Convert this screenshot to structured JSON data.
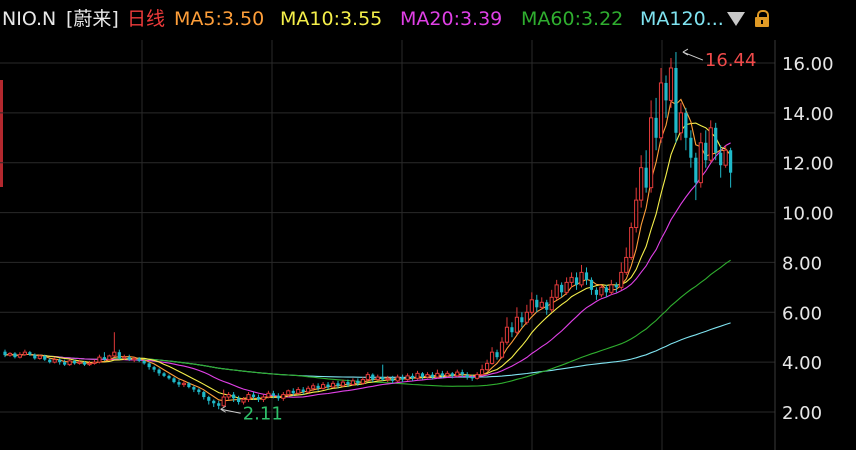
{
  "header": {
    "symbol": "NIO.N",
    "name": "[蔚来]",
    "period": "日线",
    "ma5": "MA5:3.50",
    "ma10": "MA10:3.55",
    "ma20": "MA20:3.39",
    "ma60": "MA60:3.22",
    "ma120": "MA120..."
  },
  "colors": {
    "background": "#000000",
    "up": "#e03a3a",
    "down": "#1fb9c9",
    "ma5": "#ff9f3a",
    "ma10": "#f5ef4a",
    "ma20": "#e040e6",
    "ma60": "#2fae2f",
    "ma120": "#7fe3f0",
    "grid": "#2a2a2a",
    "max_label": "#f04a4a",
    "min_label": "#2fc06a"
  },
  "icons": [
    "dropdown-triangle-icon",
    "lock-icon"
  ],
  "chart_data": {
    "type": "candlestick",
    "grid": true,
    "y_axis_position": "right",
    "ylim": [
      1.25,
      17.3
    ],
    "y_ticks": [
      2,
      4,
      6,
      8,
      10,
      12,
      14,
      16
    ],
    "y_tick_labels": [
      "2.00",
      "4.00",
      "6.00",
      "8.00",
      "10.00",
      "12.00",
      "14.00",
      "16.00"
    ],
    "annotations": [
      {
        "label": "16.44",
        "kind": "max",
        "value": 16.44,
        "candle_index": 136
      },
      {
        "label": "2.11",
        "kind": "min",
        "value": 2.11,
        "candle_index": 43
      }
    ],
    "candles": [
      [
        4.42,
        4.28,
        4.5,
        4.2
      ],
      [
        4.28,
        4.35,
        4.4,
        4.22
      ],
      [
        4.35,
        4.2,
        4.4,
        4.15
      ],
      [
        4.2,
        4.3,
        4.4,
        4.15
      ],
      [
        4.3,
        4.4,
        4.5,
        4.25
      ],
      [
        4.4,
        4.3,
        4.45,
        4.25
      ],
      [
        4.3,
        4.15,
        4.35,
        4.1
      ],
      [
        4.15,
        4.25,
        4.3,
        4.1
      ],
      [
        4.25,
        4.1,
        4.3,
        4.05
      ],
      [
        4.1,
        4.0,
        4.15,
        3.95
      ],
      [
        4.0,
        4.1,
        4.2,
        3.95
      ],
      [
        4.1,
        4.0,
        4.15,
        3.9
      ],
      [
        4.0,
        3.9,
        4.1,
        3.85
      ],
      [
        3.9,
        4.05,
        4.1,
        3.85
      ],
      [
        4.05,
        3.95,
        4.1,
        3.9
      ],
      [
        3.95,
        4.0,
        4.1,
        3.9
      ],
      [
        4.0,
        3.9,
        4.05,
        3.85
      ],
      [
        3.9,
        3.95,
        4.05,
        3.85
      ],
      [
        3.95,
        4.0,
        4.1,
        3.9
      ],
      [
        4.0,
        4.2,
        4.3,
        3.95
      ],
      [
        4.2,
        4.1,
        4.4,
        4.05
      ],
      [
        4.1,
        4.25,
        4.3,
        4.05
      ],
      [
        4.25,
        4.4,
        5.2,
        4.2
      ],
      [
        4.4,
        4.15,
        4.5,
        4.1
      ],
      [
        4.15,
        4.2,
        4.3,
        4.1
      ],
      [
        4.2,
        4.1,
        4.3,
        4.05
      ],
      [
        4.1,
        4.15,
        4.2,
        4.0
      ],
      [
        4.15,
        4.05,
        4.2,
        4.0
      ],
      [
        4.05,
        3.95,
        4.1,
        3.9
      ],
      [
        3.95,
        3.8,
        4.0,
        3.7
      ],
      [
        3.8,
        3.7,
        3.85,
        3.6
      ],
      [
        3.7,
        3.55,
        3.75,
        3.45
      ],
      [
        3.55,
        3.45,
        3.6,
        3.4
      ],
      [
        3.45,
        3.35,
        3.5,
        3.3
      ],
      [
        3.35,
        3.2,
        3.4,
        3.15
      ],
      [
        3.2,
        3.1,
        3.3,
        3.0
      ],
      [
        3.1,
        3.15,
        3.25,
        3.0
      ],
      [
        3.15,
        3.0,
        3.2,
        2.95
      ],
      [
        3.0,
        2.9,
        3.05,
        2.8
      ],
      [
        2.9,
        2.8,
        2.95,
        2.7
      ],
      [
        2.8,
        2.6,
        2.85,
        2.5
      ],
      [
        2.6,
        2.45,
        2.65,
        2.3
      ],
      [
        2.45,
        2.35,
        2.5,
        2.2
      ],
      [
        2.35,
        2.25,
        2.45,
        2.11
      ],
      [
        2.25,
        2.6,
        2.9,
        2.2
      ],
      [
        2.6,
        2.7,
        2.8,
        2.5
      ],
      [
        2.7,
        2.55,
        2.8,
        2.4
      ],
      [
        2.55,
        2.4,
        2.65,
        2.3
      ],
      [
        2.4,
        2.5,
        2.6,
        2.3
      ],
      [
        2.5,
        2.7,
        2.8,
        2.4
      ],
      [
        2.7,
        2.6,
        2.8,
        2.5
      ],
      [
        2.6,
        2.5,
        2.7,
        2.4
      ],
      [
        2.5,
        2.6,
        2.7,
        2.4
      ],
      [
        2.6,
        2.75,
        2.85,
        2.55
      ],
      [
        2.75,
        2.65,
        2.85,
        2.55
      ],
      [
        2.65,
        2.55,
        2.75,
        2.45
      ],
      [
        2.55,
        2.7,
        2.8,
        2.45
      ],
      [
        2.7,
        2.85,
        2.9,
        2.6
      ],
      [
        2.85,
        2.75,
        2.95,
        2.65
      ],
      [
        2.75,
        2.9,
        3.0,
        2.7
      ],
      [
        2.9,
        2.8,
        3.0,
        2.7
      ],
      [
        2.8,
        2.95,
        3.05,
        2.75
      ],
      [
        2.95,
        3.05,
        3.15,
        2.85
      ],
      [
        3.05,
        2.95,
        3.15,
        2.85
      ],
      [
        2.95,
        3.1,
        3.2,
        2.9
      ],
      [
        3.1,
        3.0,
        3.2,
        2.9
      ],
      [
        3.0,
        3.15,
        3.25,
        2.95
      ],
      [
        3.15,
        3.05,
        3.25,
        2.95
      ],
      [
        3.05,
        3.2,
        3.3,
        3.0
      ],
      [
        3.2,
        3.1,
        3.3,
        3.0
      ],
      [
        3.1,
        3.25,
        3.35,
        3.05
      ],
      [
        3.25,
        3.15,
        3.35,
        3.05
      ],
      [
        3.15,
        3.3,
        3.4,
        3.1
      ],
      [
        3.3,
        3.5,
        3.6,
        3.2
      ],
      [
        3.5,
        3.3,
        3.55,
        3.2
      ],
      [
        3.3,
        3.4,
        3.5,
        3.25
      ],
      [
        3.4,
        3.3,
        3.9,
        3.25
      ],
      [
        3.3,
        3.35,
        3.45,
        3.2
      ],
      [
        3.35,
        3.25,
        3.45,
        3.15
      ],
      [
        3.25,
        3.4,
        3.5,
        3.2
      ],
      [
        3.4,
        3.3,
        3.5,
        3.2
      ],
      [
        3.3,
        3.45,
        3.55,
        3.25
      ],
      [
        3.45,
        3.35,
        3.55,
        3.25
      ],
      [
        3.35,
        3.55,
        3.65,
        3.3
      ],
      [
        3.55,
        3.4,
        3.6,
        3.3
      ],
      [
        3.4,
        3.5,
        3.6,
        3.35
      ],
      [
        3.5,
        3.4,
        3.6,
        3.3
      ],
      [
        3.4,
        3.55,
        3.7,
        3.35
      ],
      [
        3.55,
        3.45,
        3.65,
        3.35
      ],
      [
        3.45,
        3.55,
        3.65,
        3.4
      ],
      [
        3.55,
        3.45,
        3.6,
        3.35
      ],
      [
        3.45,
        3.6,
        3.7,
        3.4
      ],
      [
        3.6,
        3.5,
        3.7,
        3.4
      ],
      [
        3.5,
        3.4,
        3.6,
        3.3
      ],
      [
        3.4,
        3.35,
        3.5,
        3.25
      ],
      [
        3.35,
        3.5,
        3.6,
        3.3
      ],
      [
        3.5,
        3.7,
        3.9,
        3.45
      ],
      [
        3.7,
        3.95,
        4.1,
        3.65
      ],
      [
        3.95,
        4.4,
        4.6,
        3.9
      ],
      [
        4.4,
        4.2,
        4.5,
        4.1
      ],
      [
        4.2,
        4.8,
        5.0,
        4.15
      ],
      [
        4.8,
        5.4,
        5.8,
        4.7
      ],
      [
        5.4,
        5.2,
        5.6,
        5.0
      ],
      [
        5.2,
        5.8,
        6.2,
        5.1
      ],
      [
        5.8,
        5.6,
        6.0,
        5.4
      ],
      [
        5.6,
        6.0,
        6.3,
        5.5
      ],
      [
        6.0,
        6.5,
        6.8,
        5.9
      ],
      [
        6.5,
        6.2,
        6.7,
        6.0
      ],
      [
        6.2,
        6.4,
        6.6,
        6.1
      ],
      [
        6.4,
        6.1,
        6.5,
        5.9
      ],
      [
        6.1,
        6.6,
        6.9,
        6.0
      ],
      [
        6.6,
        7.1,
        7.3,
        6.5
      ],
      [
        7.1,
        6.8,
        7.2,
        6.6
      ],
      [
        6.8,
        7.2,
        7.4,
        6.7
      ],
      [
        7.2,
        7.4,
        7.6,
        7.0
      ],
      [
        7.4,
        7.1,
        7.6,
        6.9
      ],
      [
        7.1,
        7.6,
        7.9,
        7.0
      ],
      [
        7.6,
        7.3,
        7.8,
        7.1
      ],
      [
        7.3,
        6.9,
        7.4,
        6.7
      ],
      [
        6.9,
        6.7,
        7.0,
        6.5
      ],
      [
        6.7,
        7.0,
        7.1,
        6.6
      ],
      [
        7.0,
        6.8,
        7.1,
        6.6
      ],
      [
        6.8,
        7.1,
        7.3,
        6.7
      ],
      [
        7.1,
        7.0,
        7.2,
        6.8
      ],
      [
        7.0,
        7.6,
        8.0,
        6.9
      ],
      [
        7.6,
        8.2,
        8.6,
        7.5
      ],
      [
        8.2,
        9.4,
        9.6,
        8.1
      ],
      [
        9.4,
        10.5,
        11.0,
        9.2
      ],
      [
        10.5,
        11.8,
        12.3,
        10.2
      ],
      [
        11.8,
        11.0,
        12.5,
        10.8
      ],
      [
        11.0,
        13.8,
        14.5,
        10.8
      ],
      [
        13.8,
        13.0,
        14.6,
        12.5
      ],
      [
        13.0,
        15.2,
        15.8,
        12.8
      ],
      [
        15.2,
        14.5,
        15.5,
        13.8
      ],
      [
        14.5,
        15.8,
        16.2,
        14.2
      ],
      [
        15.8,
        13.2,
        16.44,
        12.8
      ],
      [
        13.2,
        14.0,
        14.4,
        12.9
      ],
      [
        14.0,
        13.0,
        14.2,
        12.5
      ],
      [
        13.0,
        12.2,
        13.3,
        11.8
      ],
      [
        12.2,
        11.2,
        12.4,
        10.5
      ],
      [
        11.2,
        12.8,
        13.2,
        11.0
      ],
      [
        12.8,
        12.1,
        13.3,
        11.8
      ],
      [
        12.1,
        13.4,
        13.7,
        12.0
      ],
      [
        13.4,
        12.4,
        13.6,
        12.1
      ],
      [
        12.4,
        11.9,
        12.7,
        11.4
      ],
      [
        11.9,
        12.5,
        12.7,
        11.8
      ],
      [
        12.5,
        11.6,
        12.6,
        11.0
      ]
    ],
    "ma_lines": [
      {
        "key": "ma5",
        "label": "MA5:3.50"
      },
      {
        "key": "ma10",
        "label": "MA10:3.55"
      },
      {
        "key": "ma20",
        "label": "MA20:3.39"
      },
      {
        "key": "ma60",
        "label": "MA60:3.22"
      },
      {
        "key": "ma120",
        "label": "MA120..."
      }
    ]
  }
}
